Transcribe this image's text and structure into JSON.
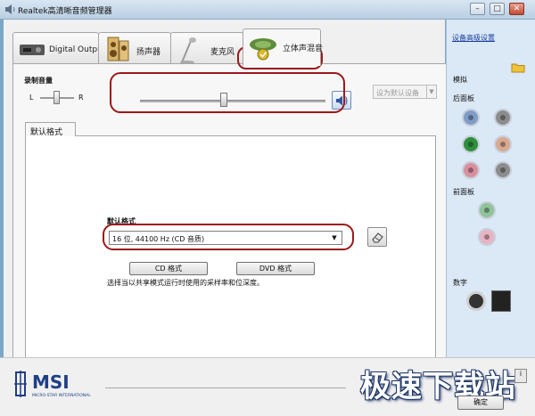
{
  "window": {
    "title": "Realtek高清晰音频管理器",
    "minimize": "–",
    "maximize": "□",
    "close": "✕"
  },
  "tabs": [
    {
      "label": "Digital Output"
    },
    {
      "label": "扬声器"
    },
    {
      "label": "麦克风"
    },
    {
      "label": "立体声混音"
    }
  ],
  "volume": {
    "title": "录制音量",
    "left": "L",
    "right": "R",
    "default_device": "设为默认设备",
    "balance": 0.5,
    "level": 0.45
  },
  "format": {
    "tab_label": "默认格式",
    "label": "默认格式",
    "selected": "16 位, 44100 Hz (CD 音质)",
    "cd_button": "CD 格式",
    "dvd_button": "DVD 格式",
    "description": "选择当以共享模式运行时使用的采样率和位深度。"
  },
  "right_panel": {
    "advanced_link": "设备高级设置",
    "analog_heading": "模拟",
    "back_heading": "后面板",
    "front_heading": "前面板",
    "digital_heading": "数字",
    "jack_colors": {
      "blue": "#7f9cc8",
      "green": "#2d8f3c",
      "pink": "#d98f9e",
      "orange": "#d8a890",
      "gray": "#8c8c8c",
      "front_green": "#8fc39a",
      "front_pink": "#e8b3c2"
    }
  },
  "brand": {
    "logo": "MSI",
    "tagline": "MICRO-STAR INTERNATIONAL"
  },
  "watermark": "极速下载站",
  "ok_button": "确定",
  "info_button": "i"
}
